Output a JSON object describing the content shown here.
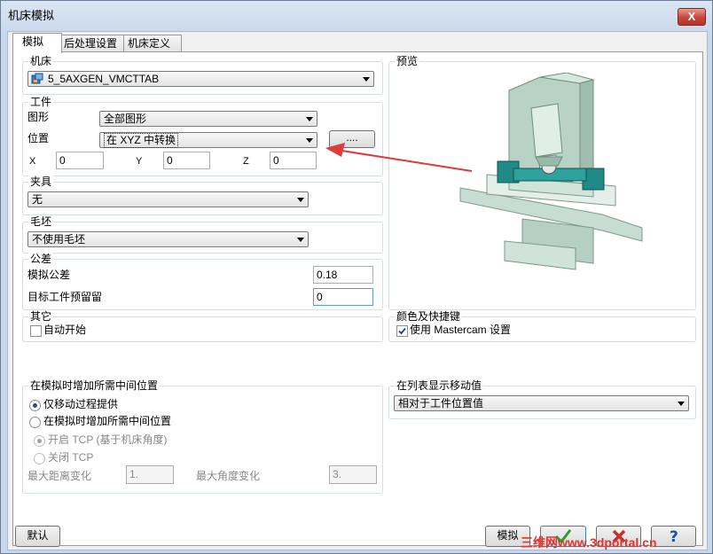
{
  "window": {
    "title": "机床模拟",
    "close_label": "X"
  },
  "tabs": [
    {
      "label": "模拟"
    },
    {
      "label": "后处理设置"
    },
    {
      "label": "机床定义"
    }
  ],
  "machine": {
    "group_label": "机床",
    "selected": "5_5AXGEN_VMCTTAB"
  },
  "workpiece": {
    "group_label": "工件",
    "shape_label": "图形",
    "shape_value": "全部图形",
    "position_label": "位置",
    "position_value": "在 XYZ 中转换",
    "ellipsis_button": "....",
    "x_label": "X",
    "x_value": "0",
    "y_label": "Y",
    "y_value": "0",
    "z_label": "Z",
    "z_value": "0"
  },
  "fixture": {
    "group_label": "夹具",
    "value": "无"
  },
  "stock": {
    "group_label": "毛坯",
    "value": "不使用毛坯"
  },
  "tolerance": {
    "group_label": "公差",
    "sim_label": "模拟公差",
    "sim_value": "0.18",
    "offset_label": "目标工件预留留",
    "offset_value": "0"
  },
  "other": {
    "group_label": "其它",
    "autostart_label": "自动开始",
    "autostart_checked": false
  },
  "preview": {
    "group_label": "预览"
  },
  "colors": {
    "group_label": "颜色及快捷键",
    "use_label": "使用 Mastercam 设置",
    "use_checked": true
  },
  "intermediate": {
    "group_label": "在模拟时增加所需中间位置",
    "option1": "仅移动过程提供",
    "option2": "在模拟时增加所需中间位置",
    "tcp_on": "开启 TCP (基于机床角度)",
    "tcp_off": "关闭 TCP",
    "max_dist_label": "最大距离变化",
    "max_dist_value": "1.",
    "max_angle_label": "最大角度变化",
    "max_angle_value": "3."
  },
  "list_display": {
    "group_label": "在列表显示移动值",
    "value": "相对于工件位置值"
  },
  "footer": {
    "default_button": "默认",
    "simulate_button": "模拟",
    "watermark": "三维网www.3dportal.cn"
  },
  "accent_colors": {
    "ok_check": "#2e9c2e",
    "cancel_x": "#c8302a",
    "arrow": "#e03a3a",
    "title_bar": "#c8d7ea"
  }
}
